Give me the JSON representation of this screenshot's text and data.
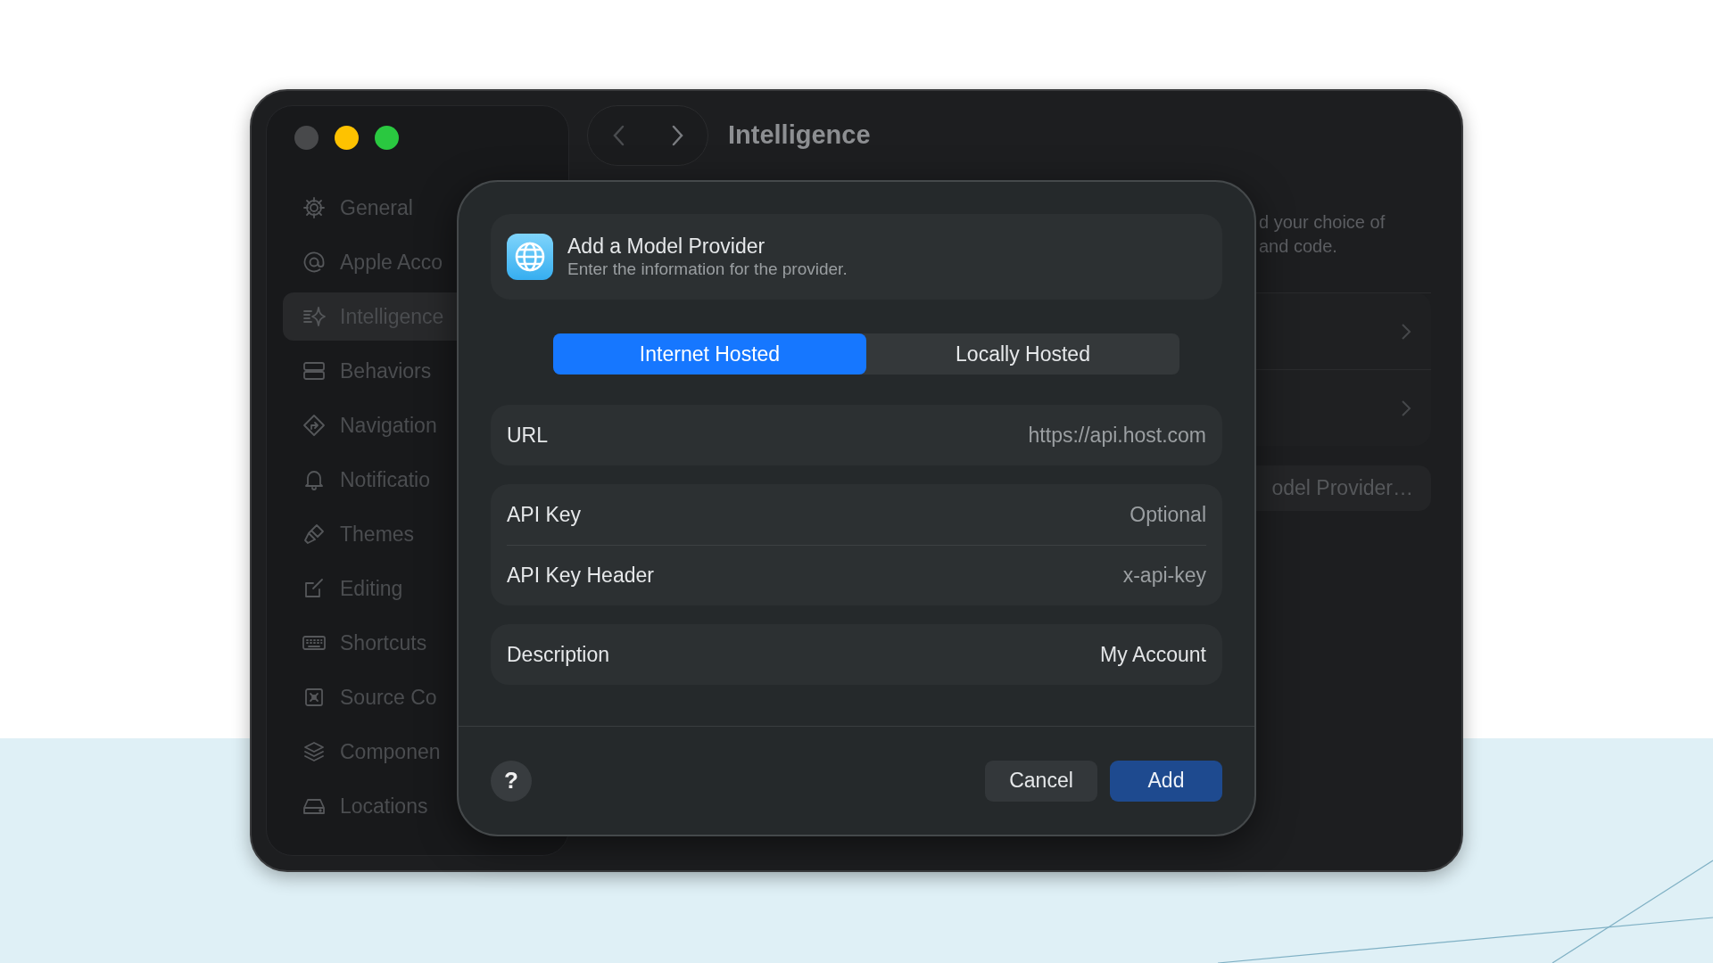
{
  "window": {
    "title": "Intelligence"
  },
  "sidebar": {
    "items": [
      {
        "label": "General",
        "selected": false
      },
      {
        "label": "Apple Acco",
        "selected": false
      },
      {
        "label": "Intelligence",
        "selected": true
      },
      {
        "label": "Behaviors",
        "selected": false
      },
      {
        "label": "Navigation",
        "selected": false
      },
      {
        "label": "Notificatio",
        "selected": false
      },
      {
        "label": "Themes",
        "selected": false
      },
      {
        "label": "Editing",
        "selected": false
      },
      {
        "label": "Shortcuts",
        "selected": false
      },
      {
        "label": "Source Co",
        "selected": false
      },
      {
        "label": "Componen",
        "selected": false
      },
      {
        "label": "Locations",
        "selected": false
      }
    ]
  },
  "content": {
    "description": "d your choice of\nand code.",
    "button": "odel Provider…"
  },
  "dialog": {
    "title": "Add a Model Provider",
    "subtitle": "Enter the information for the provider.",
    "segments": [
      {
        "label": "Internet Hosted",
        "selected": true
      },
      {
        "label": "Locally Hosted",
        "selected": false
      }
    ],
    "field_groups": [
      [
        {
          "label": "URL",
          "placeholder": "https://api.host.com"
        }
      ],
      [
        {
          "label": "API Key",
          "placeholder": "Optional"
        },
        {
          "label": "API Key Header",
          "placeholder": "x-api-key"
        }
      ],
      [
        {
          "label": "Description",
          "value": "My Account"
        }
      ]
    ],
    "help": "?",
    "cancel": "Cancel",
    "add": "Add"
  }
}
